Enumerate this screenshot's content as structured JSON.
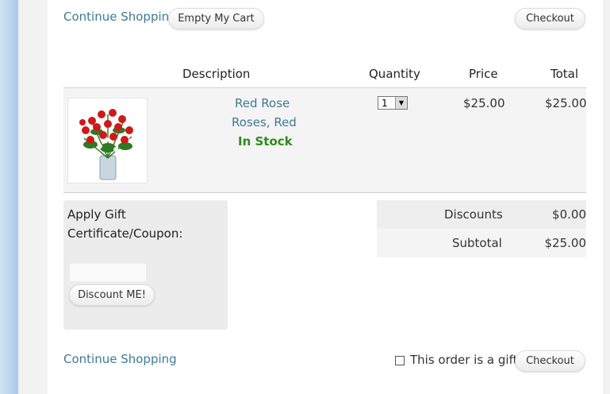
{
  "top_bar": {
    "continue_label": "Continue Shopping",
    "empty_cart_label": "Empty My Cart",
    "checkout_label": "Checkout"
  },
  "table": {
    "headers": [
      "Description",
      "Quantity",
      "Price",
      "Total"
    ]
  },
  "item": {
    "name": "Red Rose",
    "variant": "Roses, Red",
    "stock": "In Stock",
    "quantity": "1",
    "price": "$25.00",
    "total": "$25.00"
  },
  "coupon": {
    "title_line1": "Apply Gift",
    "title_line2": "Certificate/Coupon:",
    "input_value": "",
    "button_label": "Discount ME!"
  },
  "summary": {
    "discounts_label": "Discounts",
    "discounts_value": "$0.00",
    "subtotal_label": "Subtotal",
    "subtotal_value": "$25.00"
  },
  "bottom_bar": {
    "continue_label": "Continue Shopping",
    "gift_label": "This order is a gift.",
    "checkout_label": "Checkout"
  },
  "colors": {
    "link": "#3d7a9a",
    "in_stock": "#2e8b1f",
    "row_bg": "#f4f4f4"
  }
}
